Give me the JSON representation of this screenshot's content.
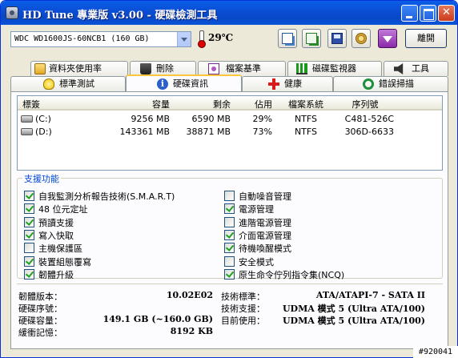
{
  "window": {
    "title": "HD Tune 專業版 v3.00 - 硬碟檢測工具"
  },
  "toolbar": {
    "drive": "WDC WD1600JS-60NCB1 (160 GB)",
    "temperature": "29",
    "temp_unit": "℃",
    "exit_label": "離開"
  },
  "tabs_top": [
    "資料夾使用率",
    "刪除",
    "檔案基準",
    "磁碟監視器",
    "工具"
  ],
  "tabs_bottom": [
    "標準測試",
    "硬碟資訊",
    "健康",
    "錯誤掃描"
  ],
  "active_tab": "硬碟資訊",
  "table": {
    "columns": [
      "標簽",
      "容量",
      "剩余",
      "佔用",
      "檔案系統",
      "序列號"
    ],
    "rows": [
      [
        "(C:)",
        "9256 MB",
        "6590 MB",
        "29%",
        "NTFS",
        "C481-526C"
      ],
      [
        "(D:)",
        "143361 MB",
        "38871 MB",
        "73%",
        "NTFS",
        "306D-6633"
      ]
    ]
  },
  "features": {
    "title": "支援功能",
    "left": [
      {
        "label": "自我監測分析報告技術(S.M.A.R.T)",
        "checked": true
      },
      {
        "label": "48 位元定址",
        "checked": true
      },
      {
        "label": "預讀支援",
        "checked": true
      },
      {
        "label": "寫入快取",
        "checked": true
      },
      {
        "label": "主機保護區",
        "checked": false
      },
      {
        "label": "裝置組態覆寫",
        "checked": true
      },
      {
        "label": "韌體升級",
        "checked": true
      }
    ],
    "right": [
      {
        "label": "自動噪音管理",
        "checked": false
      },
      {
        "label": "電源管理",
        "checked": true
      },
      {
        "label": "進階電源管理",
        "checked": false
      },
      {
        "label": "介面電源管理",
        "checked": true
      },
      {
        "label": "待機喚醒模式",
        "checked": true
      },
      {
        "label": "安全模式",
        "checked": false
      },
      {
        "label": "原生命令佇列指令集(NCQ)",
        "checked": true
      }
    ]
  },
  "info": {
    "firmware_label": "韌體版本：",
    "firmware": "10.02E02",
    "serial_label": "硬碟序號：",
    "serial": "",
    "capacity_label": "硬碟容量：",
    "capacity": "149.1 GB (~160.0 GB)",
    "buffer_label": "緩衝記憶：",
    "buffer": "8192 KB",
    "standard_label": "技術標準：",
    "standard": "ATA/ATAPI-7 - SATA II",
    "supported_label": "技術支援：",
    "supported": "UDMA 模式 5 (Ultra ATA/100)",
    "current_label": "目前使用：",
    "current": "UDMA 模式 5 (Ultra ATA/100)"
  },
  "watermark": "#920041"
}
